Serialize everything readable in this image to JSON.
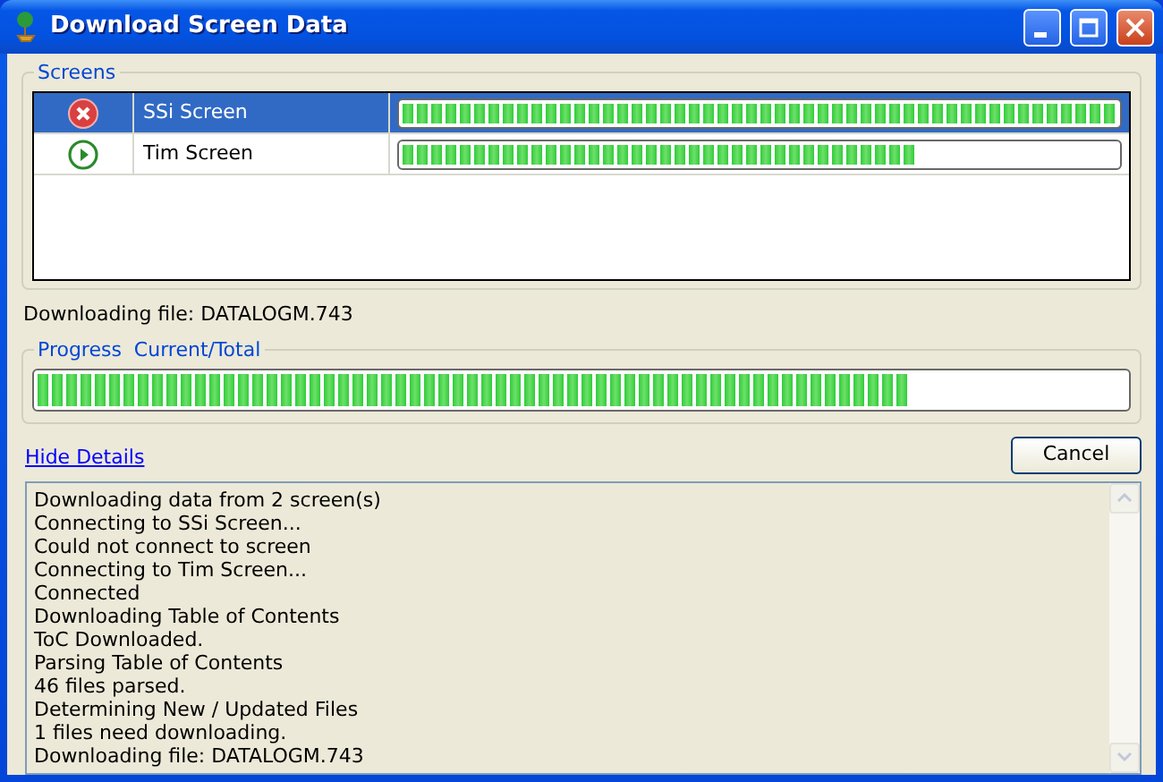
{
  "window": {
    "title": "Download Screen Data"
  },
  "screens": {
    "title": "Screens",
    "rows": [
      {
        "kind": "error",
        "name": "SSi Screen",
        "level": 1.0,
        "selected": true
      },
      {
        "kind": "running",
        "name": "Tim Screen",
        "level": 0.72,
        "selected": false
      }
    ]
  },
  "current_file": "Downloading file: DATALOGM.743",
  "progress": {
    "title": "Progress  Current/Total",
    "level": 0.8
  },
  "details_link": "Hide Details",
  "cancel_button": "Cancel",
  "log": [
    "Downloading data from 2 screen(s)",
    "Connecting to SSi Screen...",
    "Could not connect to screen",
    "Connecting to Tim Screen...",
    "Connected",
    "Downloading Table of Contents",
    "ToC Downloaded.",
    "Parsing Table of Contents",
    "46 files parsed.",
    "Determining New / Updated Files",
    "1 files need downloading.",
    "Downloading file: DATALOGM.743"
  ]
}
